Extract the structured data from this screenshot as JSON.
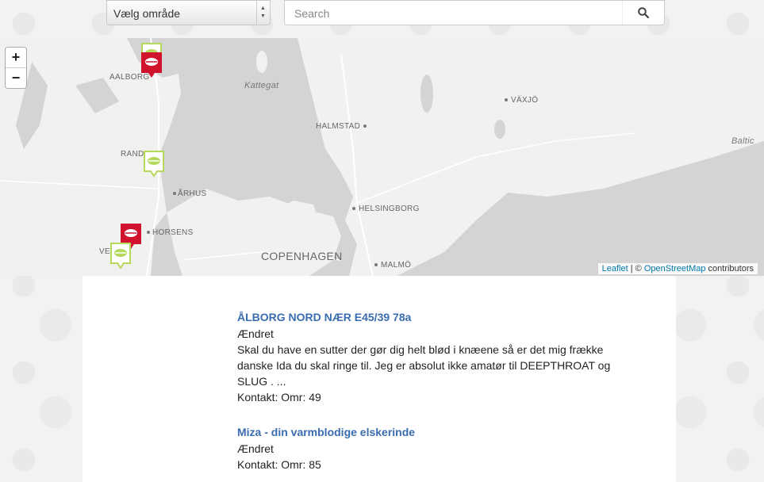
{
  "topbar": {
    "area_select": "Vælg område",
    "search_placeholder": "Search"
  },
  "map": {
    "zoom_in": "+",
    "zoom_out": "−",
    "labels": {
      "kattegat": "Kattegat",
      "aalborg": "AALBORG",
      "randers": "RAND",
      "aarhus": "ÅRHUS",
      "horsens": "HORSENS",
      "vejle": "VE",
      "halmstad": "HALMSTAD",
      "vaxjo": "VÄXJÖ",
      "baltic": "Baltic",
      "helsingborg": "HELSINGBORG",
      "copenhagen": "COPENHAGEN",
      "malmo": "MALMÖ"
    },
    "attribution": {
      "leaflet": "Leaflet",
      "sep": " | © ",
      "osm": "OpenStreetMap",
      "contributors": " contributors"
    },
    "marker_colors": {
      "red": "#d0122c",
      "green": "#b5d95a"
    }
  },
  "listings": [
    {
      "title": "ÅLBORG NORD NÆR E45/39 78a",
      "status": "Ændret",
      "description": "Skal du have en sutter der gør dig helt blød i knæene så er det mig frække danske Ida du skal ringe til. Jeg er absolut ikke amatør til DEEPTHROAT og SLUG . ...",
      "contact": "Kontakt: Omr: 49"
    },
    {
      "title": "Miza - din varmblodige elskerinde",
      "status": "Ændret",
      "contact": "Kontakt: Omr: 85"
    }
  ]
}
